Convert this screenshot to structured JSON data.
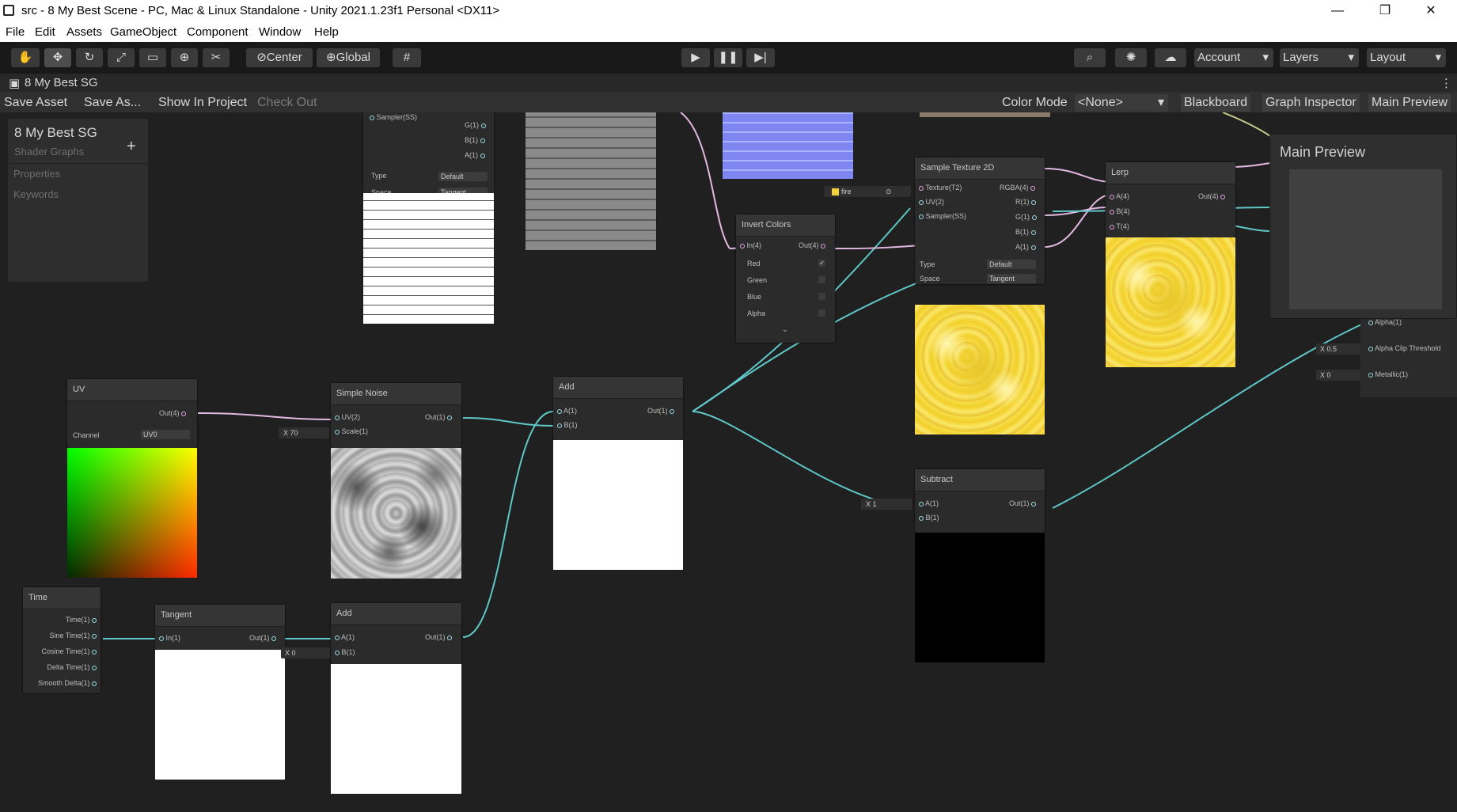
{
  "window": {
    "title": "src - 8 My Best Scene - PC, Mac & Linux Standalone - Unity 2021.1.23f1 Personal <DX11>",
    "minimize": "—",
    "maximize": "❐",
    "close": "✕"
  },
  "menu": [
    "File",
    "Edit",
    "Assets",
    "GameObject",
    "Component",
    "Window",
    "Help"
  ],
  "toolbar": {
    "center": "Center",
    "global": "Global",
    "account": "Account",
    "layers": "Layers",
    "layout": "Layout"
  },
  "tab": {
    "title": "8 My Best SG",
    "more": "⋮"
  },
  "graph_toolbar": {
    "save_asset": "Save Asset",
    "save_as": "Save As...",
    "show_in_project": "Show In Project",
    "check_out": "Check Out",
    "color_mode_label": "Color Mode",
    "color_mode_value": "<None>",
    "blackboard": "Blackboard",
    "graph_inspector": "Graph Inspector",
    "main_preview": "Main Preview"
  },
  "blackboard": {
    "title": "8 My Best SG",
    "subtitle": "Shader Graphs",
    "add": "+",
    "properties": "Properties",
    "keywords": "Keywords"
  },
  "main_preview": {
    "title": "Main Preview"
  },
  "nodes": {
    "uv": {
      "title": "UV",
      "out": "Out(4)",
      "channel_label": "Channel",
      "channel_value": "UV0"
    },
    "simple_noise": {
      "title": "Simple Noise",
      "in_uv": "UV(2)",
      "in_scale": "Scale(1)",
      "out": "Out(1)",
      "scale_x": "X",
      "scale_value": "70"
    },
    "add1": {
      "title": "Add",
      "in_a": "A(1)",
      "in_b": "B(1)",
      "out": "Out(1)"
    },
    "add2": {
      "title": "Add",
      "in_a": "A(1)",
      "in_b": "B(1)",
      "out": "Out(1)",
      "b_x": "X",
      "b_value": "0"
    },
    "time": {
      "title": "Time",
      "outs": [
        "Time(1)",
        "Sine Time(1)",
        "Cosine Time(1)",
        "Delta Time(1)",
        "Smooth Delta(1)"
      ]
    },
    "tangent": {
      "title": "Tangent",
      "in": "In(1)",
      "out": "Out(1)"
    },
    "invert_colors": {
      "title": "Invert Colors",
      "in": "In(4)",
      "out": "Out(4)",
      "channels": [
        "Red",
        "Green",
        "Blue",
        "Alpha"
      ]
    },
    "sample_texture": {
      "title": "Sample Texture 2D",
      "inputs": [
        "Texture(T2)",
        "UV(2)",
        "Sampler(SS)"
      ],
      "outputs": [
        "RGBA(4)",
        "R(1)",
        "G(1)",
        "B(1)",
        "A(1)"
      ],
      "type_label": "Type",
      "type_value": "Default",
      "space_label": "Space",
      "space_value": "Tangent",
      "texture_name": "fire"
    },
    "lerp": {
      "title": "Lerp",
      "inputs": [
        "A(4)",
        "B(4)",
        "T(4)"
      ],
      "out": "Out(4)"
    },
    "subtract": {
      "title": "Subtract",
      "in_a": "A(1)",
      "in_b": "B(1)",
      "out": "Out(1)",
      "a_x": "X",
      "a_value": "1"
    },
    "top_left_sampler": {
      "sampler": "Sampler(SS)",
      "outs": [
        "G(1)",
        "B(1)",
        "A(1)"
      ],
      "type_label": "Type",
      "type_value": "Default",
      "space_label": "Space",
      "space_value": "Tangent"
    },
    "master": {
      "alpha": "Alpha(1)",
      "alpha_clip": "Alpha Clip Threshold",
      "alpha_clip_value": "0.5",
      "metallic": "Metallic(1)",
      "metallic_value": "0",
      "x": "X"
    }
  }
}
